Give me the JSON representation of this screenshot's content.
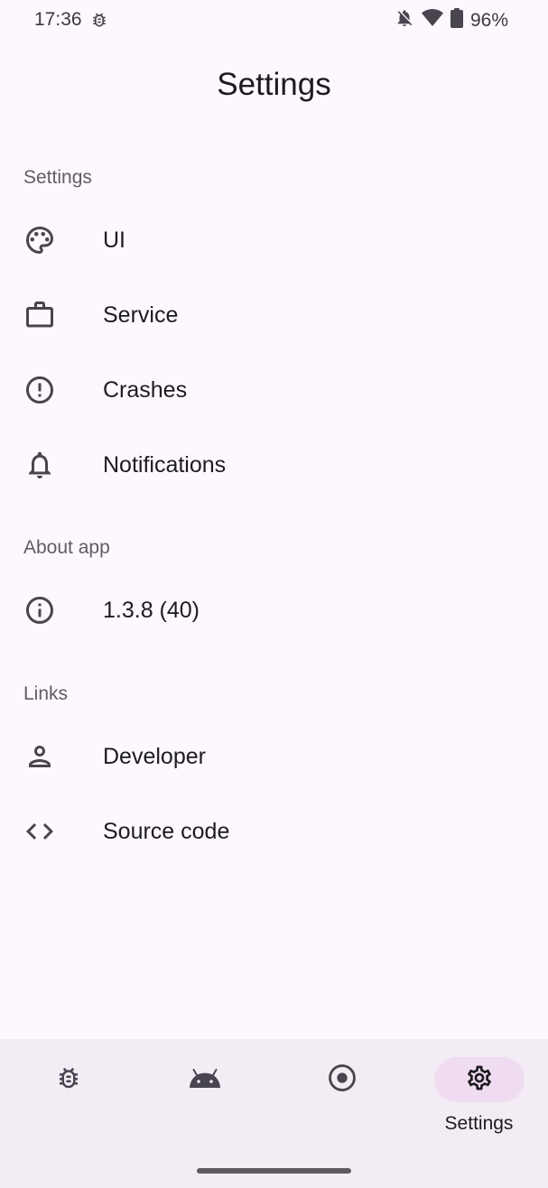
{
  "status_bar": {
    "time": "17:36",
    "battery": "96%",
    "icons": [
      "bug-icon",
      "notifications-off-icon",
      "wifi-icon",
      "battery-icon"
    ]
  },
  "header": {
    "title": "Settings"
  },
  "sections": {
    "settings": {
      "header": "Settings",
      "items": [
        {
          "label": "UI",
          "icon": "palette-icon"
        },
        {
          "label": "Service",
          "icon": "briefcase-icon"
        },
        {
          "label": "Crashes",
          "icon": "error-icon"
        },
        {
          "label": "Notifications",
          "icon": "bell-icon"
        }
      ]
    },
    "about": {
      "header": "About app",
      "items": [
        {
          "label": "1.3.8 (40)",
          "icon": "info-icon"
        }
      ]
    },
    "links": {
      "header": "Links",
      "items": [
        {
          "label": "Developer",
          "icon": "person-icon"
        },
        {
          "label": "Source code",
          "icon": "code-icon"
        }
      ]
    }
  },
  "bottom_nav": {
    "items": [
      {
        "id": "bug",
        "icon": "bug-icon",
        "label": ""
      },
      {
        "id": "android",
        "icon": "android-icon",
        "label": ""
      },
      {
        "id": "record",
        "icon": "radio-button-icon",
        "label": ""
      },
      {
        "id": "settings",
        "icon": "gear-icon",
        "label": "Settings",
        "active": true
      }
    ]
  },
  "colors": {
    "background": "#fdf8fd",
    "nav_background": "#f3ecf4",
    "active_indicator": "#f0dcf0",
    "icon": "#49454f",
    "section_header": "#625b66"
  }
}
